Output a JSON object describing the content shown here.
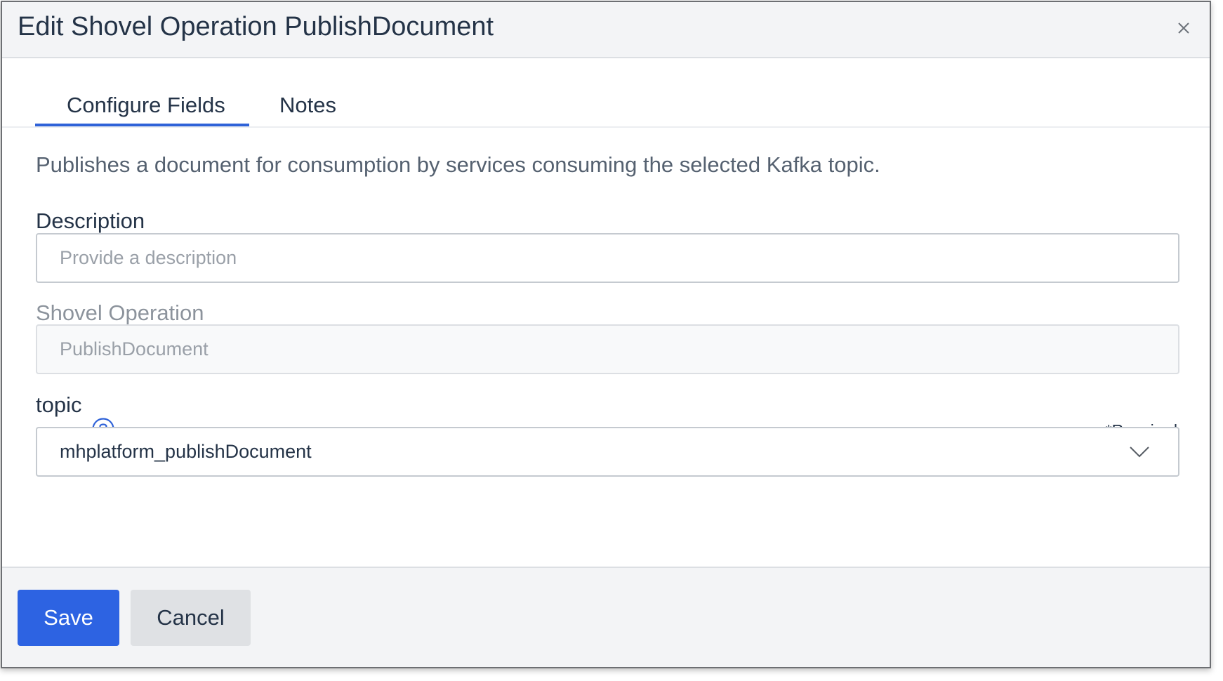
{
  "dialog": {
    "title": "Edit Shovel Operation PublishDocument",
    "close_icon": "close-icon"
  },
  "tabs": [
    {
      "label": "Configure Fields",
      "active": true
    },
    {
      "label": "Notes",
      "active": false
    }
  ],
  "intro_text": "Publishes a document for consumption by services consuming the selected Kafka topic.",
  "fields": {
    "description": {
      "label": "Description",
      "value": "",
      "placeholder": "Provide a description"
    },
    "shovel_operation": {
      "label": "Shovel Operation",
      "value": "PublishDocument",
      "disabled": true
    },
    "topic": {
      "label": "topic",
      "help_icon": "question-circle-icon",
      "required_label": "*Required",
      "selected": "mhplatform_publishDocument",
      "dropdown_icon": "chevron-down-icon"
    }
  },
  "footer": {
    "save_label": "Save",
    "cancel_label": "Cancel"
  },
  "colors": {
    "accent": "#2d63e2",
    "tab_underline": "#2f62d8",
    "text": "#243347",
    "header_bg": "#f3f4f6"
  }
}
